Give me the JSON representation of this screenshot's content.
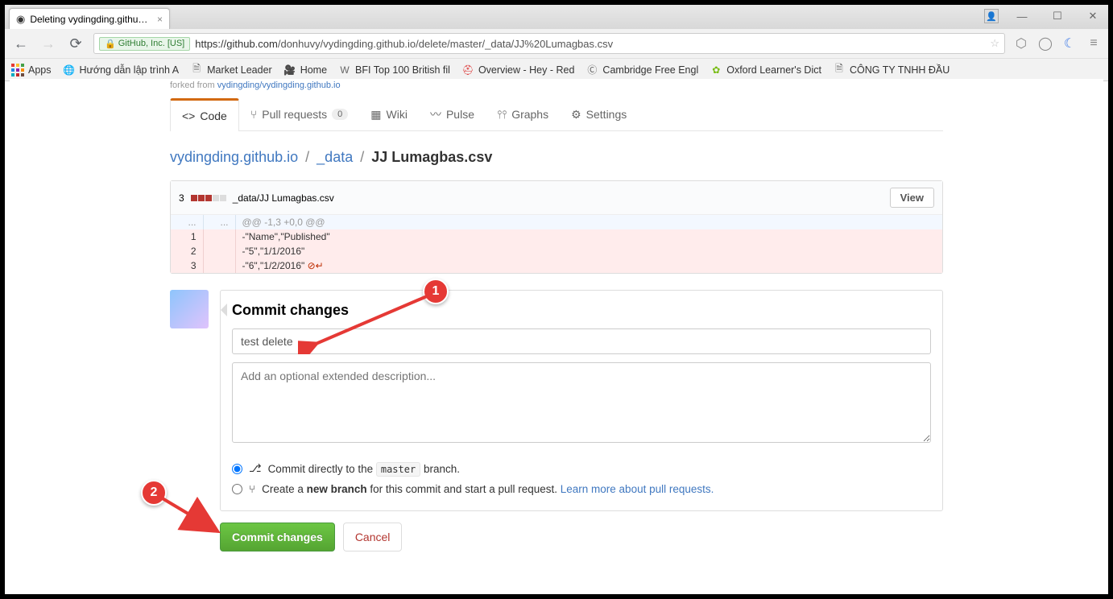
{
  "browser": {
    "tab_title": "Deleting vydingding.githu…",
    "ssl_label": "GitHub, Inc. [US]",
    "url_host": "https://github.com",
    "url_path": "/donhuvy/vydingding.github.io/delete/master/_data/JJ%20Lumagbas.csv",
    "win_min": "—",
    "win_max": "☐",
    "win_close": "✕"
  },
  "bookmarks": {
    "apps": "Apps",
    "items": [
      "Hướng dẫn lập trình A",
      "Market Leader",
      "Home",
      "BFI Top 100 British fil",
      "Overview - Hey - Red",
      "Cambridge Free Engl",
      "Oxford Learner's Dict",
      "CÔNG TY TNHH ĐẦU"
    ]
  },
  "repo": {
    "forked_prefix": "forked from ",
    "forked_link": "vydingding/vydingding.github.io",
    "tabs": {
      "code": "Code",
      "pulls": "Pull requests",
      "pulls_count": "0",
      "wiki": "Wiki",
      "pulse": "Pulse",
      "graphs": "Graphs",
      "settings": "Settings"
    }
  },
  "breadcrumb": {
    "repo": "vydingding.github.io",
    "folder": "_data",
    "file": "JJ Lumagbas.csv"
  },
  "diff": {
    "changed_count": "3",
    "filepath": "_data/JJ Lumagbas.csv",
    "view_btn": "View",
    "hunk": "@@ -1,3 +0,0 @@",
    "lines": [
      {
        "n": "1",
        "text": "-\"Name\",\"Published\""
      },
      {
        "n": "2",
        "text": "-\"5\",\"1/1/2016\""
      },
      {
        "n": "3",
        "text": "-\"6\",\"1/2/2016\" "
      }
    ],
    "no_newline": "⊘↵"
  },
  "commit": {
    "heading": "Commit changes",
    "summary_value": "test delete",
    "desc_placeholder": "Add an optional extended description...",
    "radio1_pre": "Commit directly to the ",
    "radio1_code": "master",
    "radio1_post": " branch.",
    "radio2_pre": "Create a ",
    "radio2_bold": "new branch",
    "radio2_post": " for this commit and start a pull request. ",
    "radio2_link": "Learn more about pull requests.",
    "submit": "Commit changes",
    "cancel": "Cancel"
  },
  "callouts": {
    "one": "1",
    "two": "2"
  }
}
